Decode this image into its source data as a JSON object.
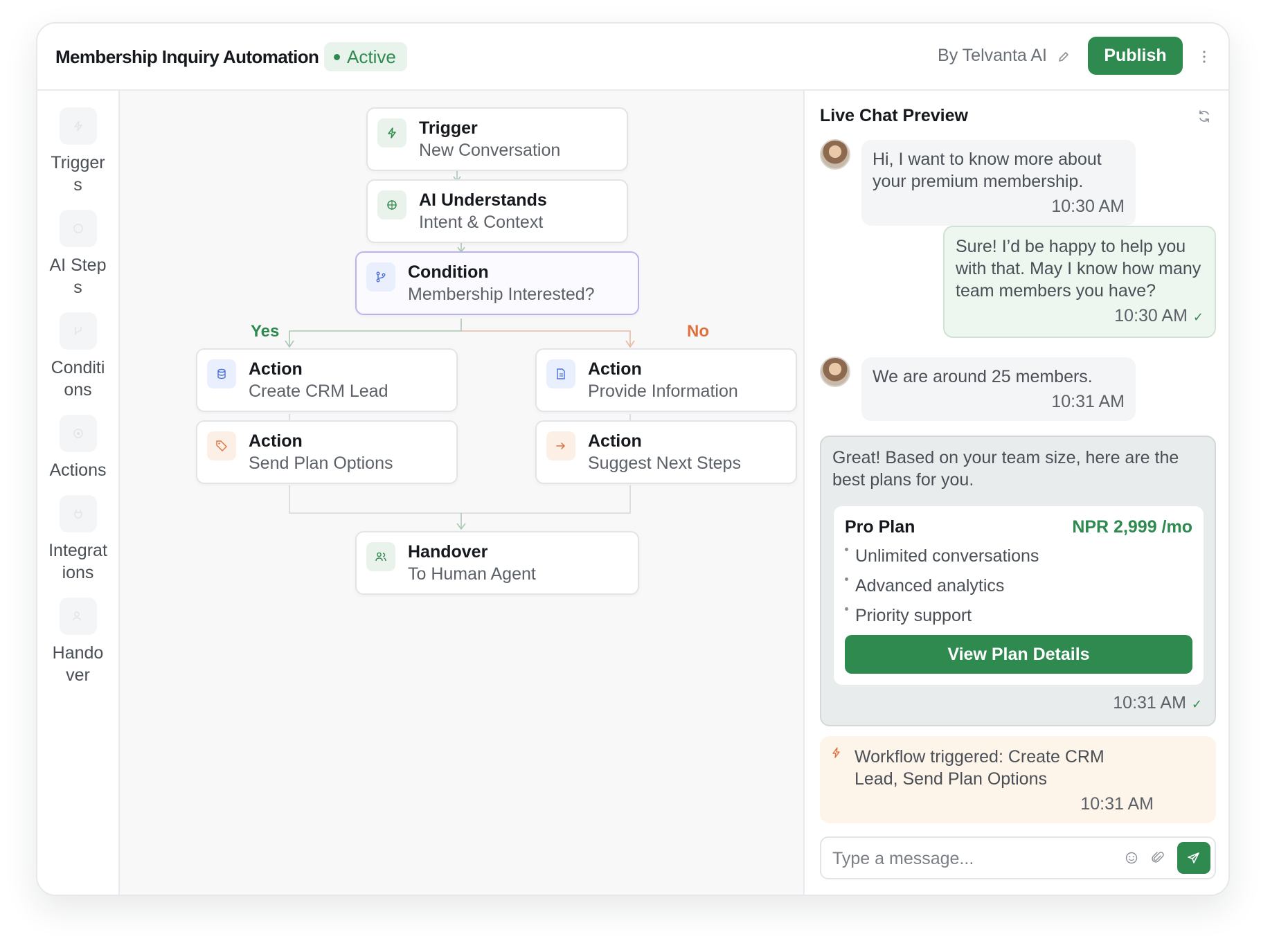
{
  "header": {
    "title": "Membership Inquiry Automation",
    "status": "Active",
    "author": "By Telvanta AI",
    "publish_label": "Publish"
  },
  "sidebar": {
    "items": [
      {
        "label": "Triggers",
        "icon": "bolt-icon"
      },
      {
        "label": "AI Steps",
        "icon": "brain-icon"
      },
      {
        "label": "Conditions",
        "icon": "branch-icon"
      },
      {
        "label": "Actions",
        "icon": "target-icon"
      },
      {
        "label": "Integrations",
        "icon": "plug-icon"
      },
      {
        "label": "Handover",
        "icon": "users-icon"
      }
    ]
  },
  "flow": {
    "trigger": {
      "title": "Trigger",
      "subtitle": "New Conversation"
    },
    "ai": {
      "title": "AI Understands",
      "subtitle": "Intent & Context"
    },
    "condition": {
      "title": "Condition",
      "subtitle": "Membership Interested?"
    },
    "yes_label": "Yes",
    "no_label": "No",
    "crm": {
      "title": "Action",
      "subtitle": "Create CRM Lead"
    },
    "info": {
      "title": "Action",
      "subtitle": "Provide Information"
    },
    "plans": {
      "title": "Action",
      "subtitle": "Send Plan Options"
    },
    "next": {
      "title": "Action",
      "subtitle": "Suggest Next Steps"
    },
    "handover": {
      "title": "Handover",
      "subtitle": "To Human Agent"
    }
  },
  "chat": {
    "title": "Live Chat Preview",
    "messages": [
      {
        "text": "Hi, I want to know more about your premium membership.",
        "time": "10:30 AM"
      },
      {
        "text": "Sure! I’d be happy to help you with that. May I know how many team members you have?",
        "time": "10:30 AM"
      },
      {
        "text": "We are around 25 members.",
        "time": "10:31 AM"
      },
      {
        "text": "Great! Based on your team size, here are the best plans for you.",
        "time": "10:31 AM"
      }
    ],
    "plan": {
      "name": "Pro Plan",
      "price": "NPR 2,999 /mo",
      "features": [
        "Unlimited conversations",
        "Advanced analytics",
        "Priority support"
      ],
      "button": "View Plan Details"
    },
    "workflow_note": {
      "text": "Workflow triggered: Create CRM Lead, Send Plan Options",
      "time": "10:31 AM"
    },
    "composer_placeholder": "Type a message..."
  },
  "colors": {
    "accent": "#2f8a4f",
    "no_branch": "#e0703e",
    "condition_border": "#b9b4ee"
  }
}
